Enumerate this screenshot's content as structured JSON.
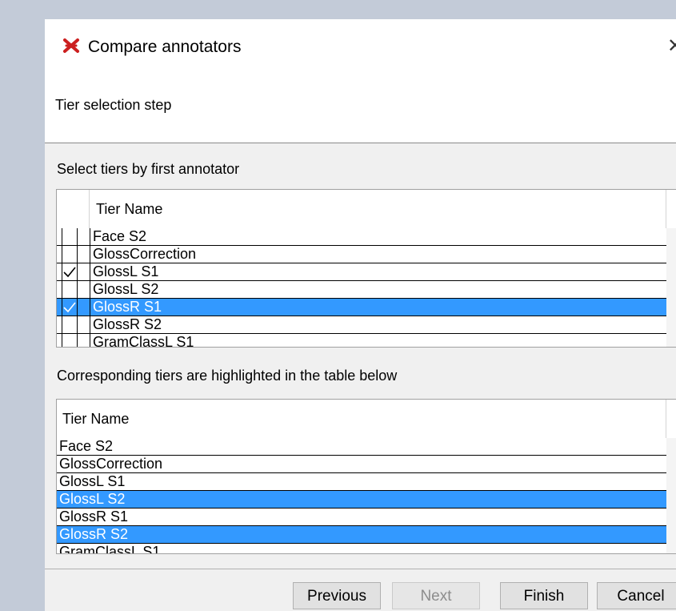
{
  "window": {
    "title": "Compare annotators",
    "app_icon": "elan-crossed-icon",
    "close_icon": "close-icon"
  },
  "header": {
    "step_title": "Tier selection step"
  },
  "first": {
    "label": "Select tiers by first annotator",
    "column_header": "Tier Name",
    "rows": [
      {
        "name": "Face S2",
        "checked": false,
        "selected": false
      },
      {
        "name": "GlossCorrection",
        "checked": false,
        "selected": false
      },
      {
        "name": "GlossL S1",
        "checked": true,
        "selected": false
      },
      {
        "name": "GlossL S2",
        "checked": false,
        "selected": false
      },
      {
        "name": "GlossR S1",
        "checked": true,
        "selected": true
      },
      {
        "name": "GlossR S2",
        "checked": false,
        "selected": false
      },
      {
        "name": "GramClassL S1",
        "checked": false,
        "selected": false
      }
    ]
  },
  "second": {
    "label": "Corresponding tiers are highlighted in the table below",
    "column_header": "Tier Name",
    "rows": [
      {
        "name": "Face S2",
        "highlighted": false
      },
      {
        "name": "GlossCorrection",
        "highlighted": false
      },
      {
        "name": "GlossL S1",
        "highlighted": false
      },
      {
        "name": "GlossL S2",
        "highlighted": true
      },
      {
        "name": "GlossR S1",
        "highlighted": false
      },
      {
        "name": "GlossR S2",
        "highlighted": true
      },
      {
        "name": "GramClassL S1",
        "highlighted": false
      }
    ]
  },
  "buttons": {
    "previous": "Previous",
    "next": "Next",
    "finish": "Finish",
    "cancel": "Cancel"
  },
  "colors": {
    "selection": "#3399ff",
    "dialog_bg": "#f0f0f0",
    "desktop_bg": "#c3cbd8"
  }
}
